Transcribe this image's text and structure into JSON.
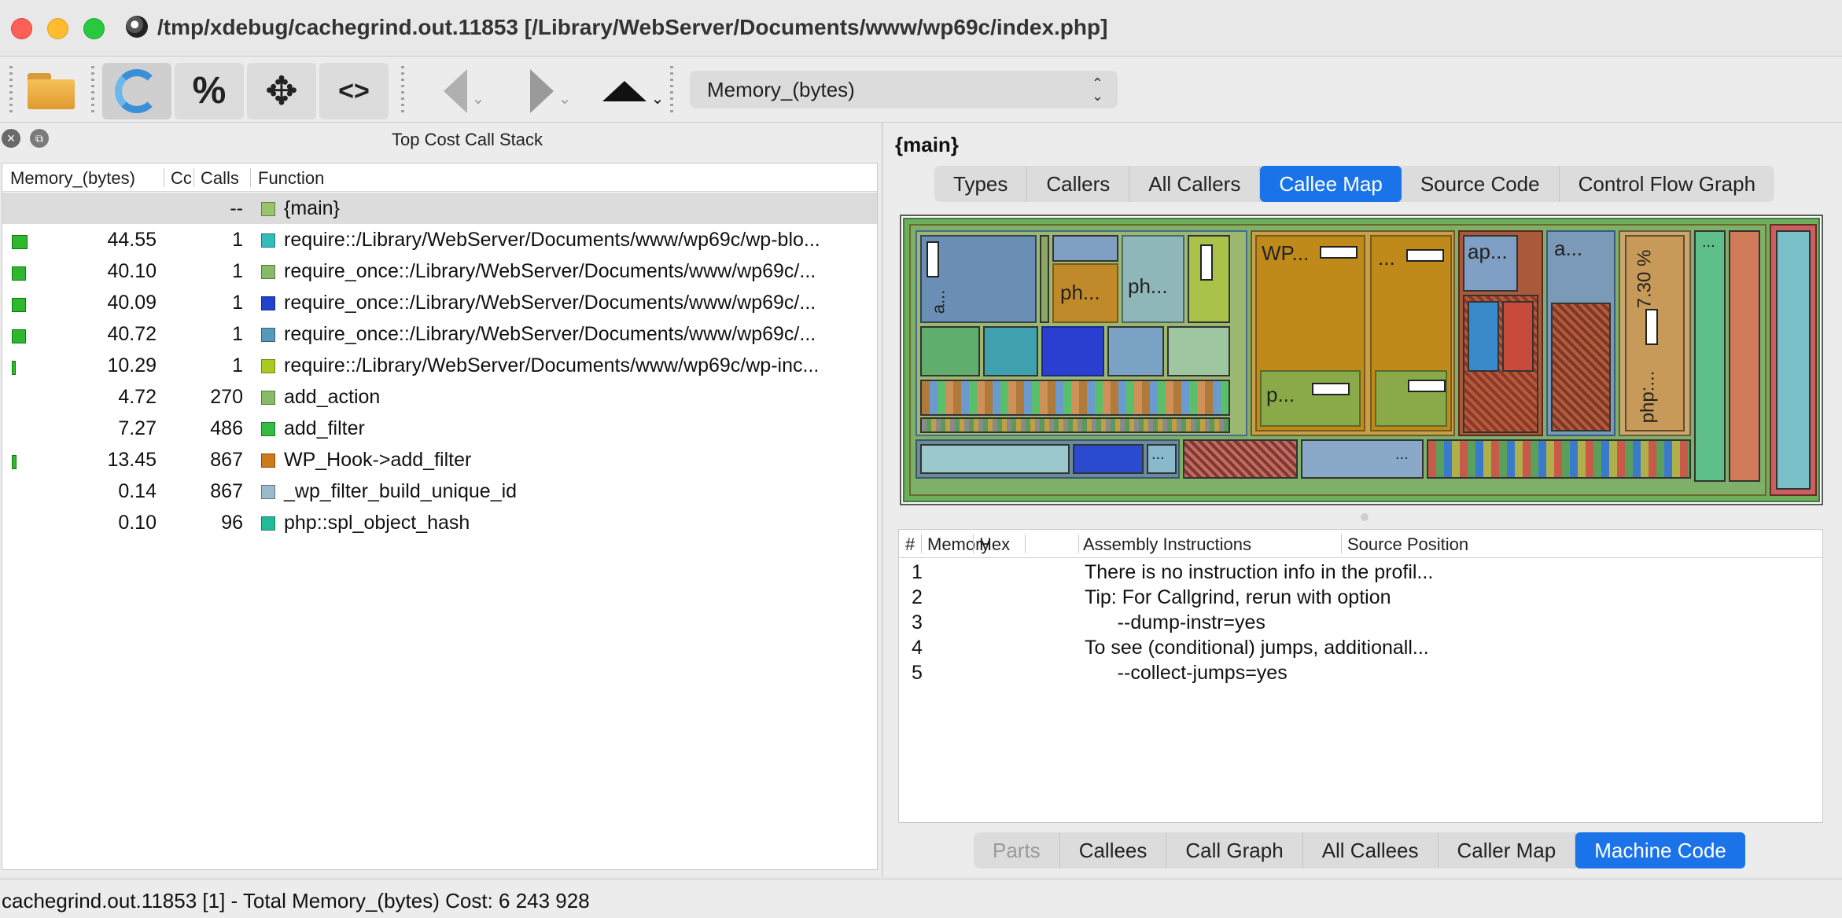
{
  "window": {
    "title": "/tmp/xdebug/cachegrind.out.11853 [/Library/WebServer/Documents/www/wp69c/index.php]"
  },
  "toolbar": {
    "open_icon": "folder-icon",
    "reload_icon": "refresh-icon",
    "percent_label": "%",
    "move_label": "✥",
    "code_label": "<>",
    "event_type": "Memory_(bytes)"
  },
  "left_panel": {
    "title": "Top Cost Call Stack",
    "columns": {
      "cost": "Memory_(bytes)",
      "cc": "Cc",
      "calls": "Calls",
      "function": "Function"
    },
    "rows": [
      {
        "cost": "",
        "calls": "--",
        "function": "{main}",
        "color": "#9ac46a",
        "bar": 0,
        "selected": true
      },
      {
        "cost": "44.55",
        "calls": "1",
        "function": "require::/Library/WebServer/Documents/www/wp69c/wp-blo...",
        "color": "#33bbbb",
        "bar": 0.4455
      },
      {
        "cost": "40.10",
        "calls": "1",
        "function": "require_once::/Library/WebServer/Documents/www/wp69c/...",
        "color": "#88bb66",
        "bar": 0.401
      },
      {
        "cost": "40.09",
        "calls": "1",
        "function": "require_once::/Library/WebServer/Documents/www/wp69c/...",
        "color": "#2244cc",
        "bar": 0.4009
      },
      {
        "cost": "40.72",
        "calls": "1",
        "function": "require_once::/Library/WebServer/Documents/www/wp69c/...",
        "color": "#5599bb",
        "bar": 0.4072
      },
      {
        "cost": "10.29",
        "calls": "1",
        "function": "require::/Library/WebServer/Documents/www/wp69c/wp-inc...",
        "color": "#aacc22",
        "bar": 0.1029
      },
      {
        "cost": "4.72",
        "calls": "270",
        "function": "add_action",
        "color": "#88bb66",
        "bar": 0
      },
      {
        "cost": "7.27",
        "calls": "486",
        "function": "add_filter",
        "color": "#33bb44",
        "bar": 0
      },
      {
        "cost": "13.45",
        "calls": "867",
        "function": "WP_Hook->add_filter",
        "color": "#cc7a1a",
        "bar": 0.1345
      },
      {
        "cost": "0.14",
        "calls": "867",
        "function": "_wp_filter_build_unique_id",
        "color": "#99bbcc",
        "bar": 0
      },
      {
        "cost": "0.10",
        "calls": "96",
        "function": "php::spl_object_hash",
        "color": "#22bb99",
        "bar": 0
      }
    ]
  },
  "right_panel": {
    "function_name": "{main}",
    "top_tabs": [
      "Types",
      "Callers",
      "All Callers",
      "Callee Map",
      "Source Code",
      "Control Flow Graph"
    ],
    "top_active": "Callee Map",
    "treemap_labels": {
      "a1": "a...",
      "ph1": "ph...",
      "ph2": "ph...",
      "wp": "WP...",
      "dots1": "...",
      "p1": "p...",
      "ap": "ap...",
      "a2": "a...",
      "pct": "7.30 %",
      "php": "php:...",
      "dots2": "...",
      "dots3": "...",
      "dots4": "..."
    },
    "asm_columns": {
      "num": "#",
      "memory": "Memory",
      "hex": "Hex",
      "instr": "Assembly Instructions",
      "source": "Source Position"
    },
    "asm_rows": [
      {
        "num": "1",
        "text": "There is no instruction info in the profil..."
      },
      {
        "num": "2",
        "text": "Tip: For Callgrind, rerun with option"
      },
      {
        "num": "3",
        "text": "      --dump-instr=yes"
      },
      {
        "num": "4",
        "text": "To see (conditional) jumps, additionall..."
      },
      {
        "num": "5",
        "text": "      --collect-jumps=yes"
      }
    ],
    "bottom_tabs": [
      "Parts",
      "Callees",
      "Call Graph",
      "All Callees",
      "Caller Map",
      "Machine Code"
    ],
    "bottom_active": "Machine Code"
  },
  "status": {
    "text": "cachegrind.out.11853 [1] - Total Memory_(bytes) Cost: 6 243 928"
  }
}
